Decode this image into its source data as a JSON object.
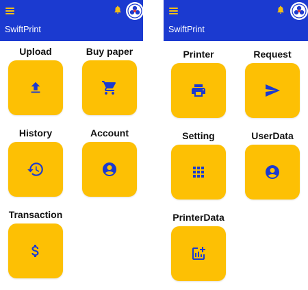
{
  "app": {
    "title": "SwiftPrint",
    "colors": {
      "appbar": "#1b3ad0",
      "accent": "#fdc004",
      "icon": "#1b3ad0",
      "menu": "#f4bf15"
    }
  },
  "left_screen": {
    "header": {
      "menu_icon": "menu-icon",
      "notification_icon": "bell-icon",
      "avatar": "avatar-logo"
    },
    "tiles": [
      {
        "label": "Upload",
        "icon": "upload-icon"
      },
      {
        "label": "Buy paper",
        "icon": "cart-icon"
      },
      {
        "label": "History",
        "icon": "history-icon"
      },
      {
        "label": "Account",
        "icon": "account-icon"
      },
      {
        "label": "Transaction",
        "icon": "dollar-icon"
      }
    ]
  },
  "right_screen": {
    "header": {
      "menu_icon": "menu-icon",
      "notification_icon": "bell-icon",
      "avatar": "avatar-logo"
    },
    "tiles": [
      {
        "label": "Printer",
        "icon": "printer-icon"
      },
      {
        "label": "Request",
        "icon": "send-icon"
      },
      {
        "label": "Setting",
        "icon": "grid-icon"
      },
      {
        "label": "UserData",
        "icon": "account-icon"
      },
      {
        "label": "PrinterData",
        "icon": "add-chart-icon"
      }
    ]
  }
}
